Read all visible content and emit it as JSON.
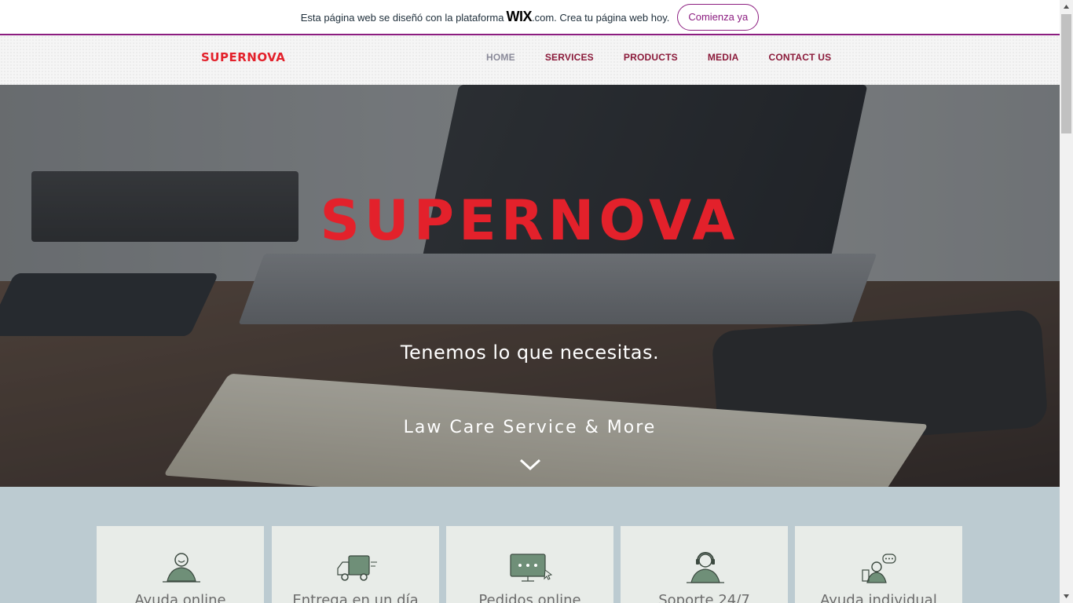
{
  "wix_banner": {
    "text_before": "Esta página web se diseñó con la plataforma",
    "wix_logo": "WIX",
    "text_after": ".com. Crea tu página web hoy.",
    "cta_label": "Comienza ya"
  },
  "header": {
    "logo": "SUPERNOVA",
    "nav": [
      {
        "label": "HOME",
        "active": true
      },
      {
        "label": "SERVICES"
      },
      {
        "label": "PRODUCTS"
      },
      {
        "label": "MEDIA"
      },
      {
        "label": "CONTACT US"
      }
    ]
  },
  "hero": {
    "logo": "SUPERNOVA",
    "tagline": "Tenemos lo que necesitas.",
    "subtagline": "Law Care Service & More",
    "scroll_icon": "chevron-down-icon"
  },
  "features": [
    {
      "label": "Ayuda online",
      "icon": "person-icon"
    },
    {
      "label": "Entrega en un día",
      "icon": "delivery-truck-icon"
    },
    {
      "label": "Pedidos online",
      "icon": "monitor-cursor-icon"
    },
    {
      "label": "Soporte 24/7",
      "icon": "headset-support-icon"
    },
    {
      "label": "Ayuda individual",
      "icon": "chat-person-icon"
    }
  ],
  "colors": {
    "brand_red": "#e3212b",
    "nav_text": "#8b1a3a",
    "nav_active": "#8a8a99",
    "wix_purple": "#8c1d80",
    "features_bg": "#bccbd1",
    "card_bg": "#e8ece8",
    "icon_green": "#6f8f78"
  }
}
